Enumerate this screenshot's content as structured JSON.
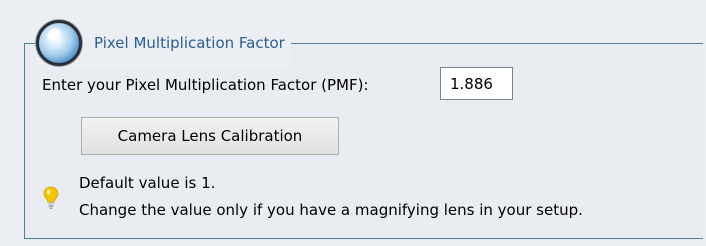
{
  "group": {
    "title": "Pixel Multiplication Factor",
    "icon": "glass-orb-icon"
  },
  "pmf": {
    "label": "Enter your Pixel Multiplication Factor (PMF):",
    "value": "1.886"
  },
  "calibration_button": {
    "label": "Camera Lens Calibration"
  },
  "hint": {
    "icon": "lightbulb-icon",
    "line1": "Default value is 1.",
    "line2": "Change the value only if you have a magnifying lens in your setup."
  },
  "colors": {
    "background": "#ebeef3",
    "border": "#4f7f93",
    "title": "#2b5e97",
    "bulb": "#f5c400"
  }
}
